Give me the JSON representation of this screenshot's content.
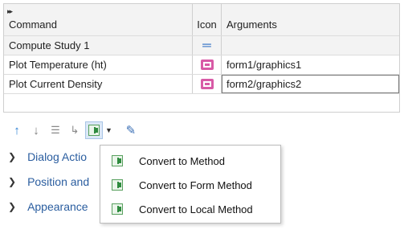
{
  "table": {
    "headers": {
      "command": "Command",
      "icon": "Icon",
      "arguments": "Arguments"
    },
    "rows": [
      {
        "command": "Compute Study 1",
        "icon": "equals-icon",
        "arguments": ""
      },
      {
        "command": "Plot Temperature (ht)",
        "icon": "plot-icon",
        "arguments": "form1/graphics1"
      },
      {
        "command": "Plot Current Density",
        "icon": "plot-icon",
        "arguments": "form2/graphics2"
      }
    ]
  },
  "toolbar": {
    "icons": [
      "move-up-icon",
      "move-down-icon",
      "delete-icon",
      "method-icon",
      "convert-method-icon",
      "dropdown-arrow-icon",
      "edit-icon"
    ]
  },
  "sections": [
    {
      "label": "Dialog Actio"
    },
    {
      "label": "Position and"
    },
    {
      "label": "Appearance"
    }
  ],
  "menu": {
    "items": [
      {
        "label": "Convert to Method"
      },
      {
        "label": "Convert to Form Method"
      },
      {
        "label": "Convert to Local Method"
      }
    ]
  },
  "colors": {
    "accent": "#2a5d9f",
    "plot_icon": "#d85aa6",
    "method_green": "#2e8b3e"
  }
}
